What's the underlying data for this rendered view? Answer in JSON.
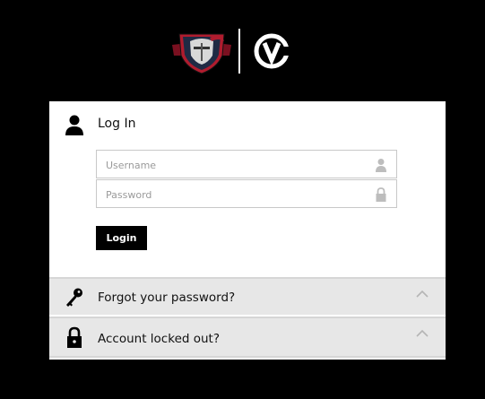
{
  "branding": {
    "crest_icon": "knight-crest-logo",
    "cv_icon": "cv-logo"
  },
  "login": {
    "title": "Log In",
    "username_placeholder": "Username",
    "password_placeholder": "Password",
    "button_label": "Login"
  },
  "accordion": {
    "forgot_label": "Forgot your password?",
    "locked_label": "Account locked out?"
  },
  "colors": {
    "background": "#000000",
    "panel": "#ffffff",
    "accordion_bg": "#e7e7e7",
    "button": "#000000",
    "crest_red": "#b01c2e",
    "crest_navy": "#1f2a44"
  }
}
